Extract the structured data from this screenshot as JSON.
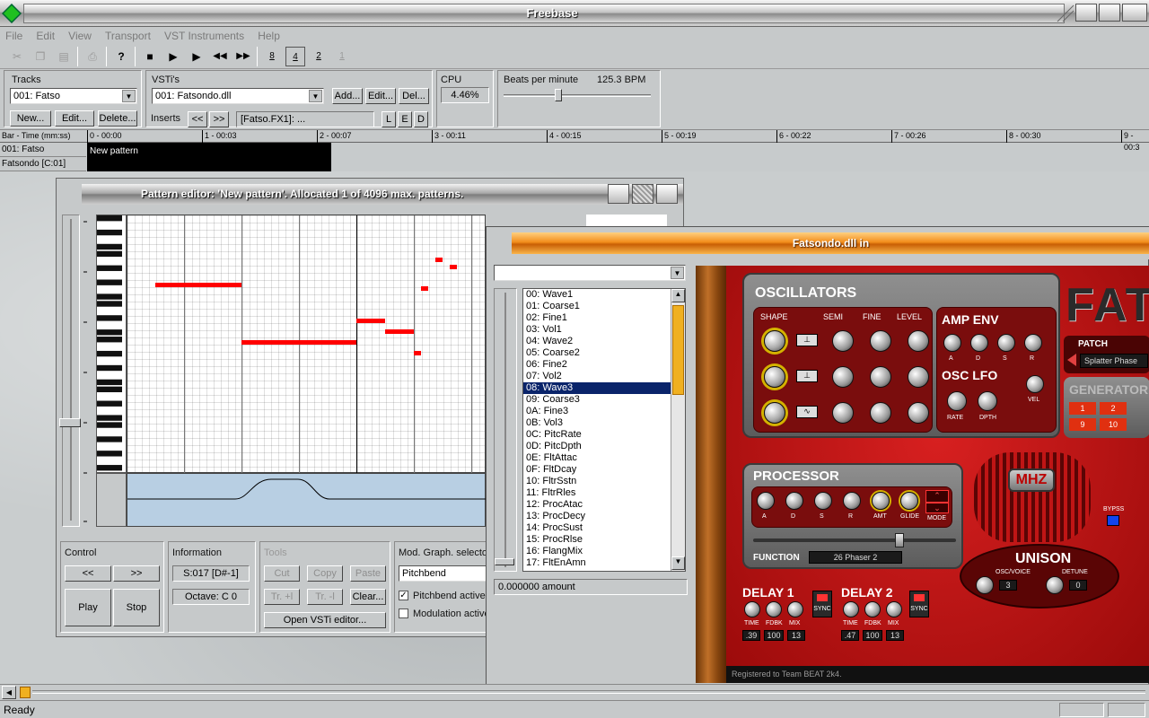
{
  "window": {
    "title": "Freebase"
  },
  "menu": [
    "File",
    "Edit",
    "View",
    "Transport",
    "VST Instruments",
    "Help"
  ],
  "tracks": {
    "label": "Tracks",
    "selected": "001: Fatso",
    "new": "New...",
    "edit": "Edit...",
    "delete": "Delete..."
  },
  "vstis": {
    "label": "VSTi's",
    "selected": "001: Fatsondo.dll",
    "add": "Add...",
    "edit": "Edit...",
    "delete": "Del...",
    "inserts_label": "Inserts",
    "prev": "<<",
    "next": ">>",
    "insert_value": "[Fatso.FX1]: ...",
    "l": "L",
    "e": "E",
    "d": "D"
  },
  "cpu": {
    "label": "CPU",
    "value": "4.46%"
  },
  "bpm": {
    "label": "Beats per minute",
    "value": "125.3 BPM",
    "slider_fraction": 0.35
  },
  "timeline": {
    "header": "Bar - Time (mm:ss)",
    "ticks": [
      "0 - 00:00",
      "1 - 00:03",
      "2 - 00:07",
      "3 - 00:11",
      "4 - 00:15",
      "5 - 00:19",
      "6 - 00:22",
      "7 - 00:26",
      "8 - 00:30",
      "9 - 00:3"
    ]
  },
  "track_rows": [
    {
      "name": "001: Fatso",
      "pattern": "New pattern"
    },
    {
      "name": "Fatsondo [C:01]"
    }
  ],
  "pattern_editor": {
    "title": "Pattern editor: 'New pattern'. Allocated 1 of 4096 max. patterns.",
    "control": {
      "label": "Control",
      "prev": "<<",
      "next": ">>",
      "play": "Play",
      "stop": "Stop"
    },
    "information": {
      "label": "Information",
      "step": "S:017 [D#-1]",
      "octave": "Octave: C 0"
    },
    "tools": {
      "label": "Tools",
      "cut": "Cut",
      "copy": "Copy",
      "paste": "Paste",
      "tr_up": "Tr. +l",
      "tr_down": "Tr. -l",
      "clear": "Clear...",
      "open_vsti": "Open VSTi editor..."
    },
    "mod_graph": {
      "label": "Mod. Graph. selector",
      "selected": "Pitchbend",
      "pitchbend_active": "Pitchbend active",
      "pitchbend_checked": true,
      "modulation_active": "Modulation active",
      "modulation_checked": false
    }
  },
  "vst_window": {
    "title": "Fatsondo.dll in",
    "params": [
      "00: Wave1",
      "01: Coarse1",
      "02: Fine1",
      "03: Vol1",
      "04: Wave2",
      "05: Coarse2",
      "06: Fine2",
      "07: Vol2",
      "08: Wave3",
      "09: Coarse3",
      "0A: Fine3",
      "0B: Vol3",
      "0C: PitcRate",
      "0D: PitcDpth",
      "0E: FltAttac",
      "0F: FltDcay",
      "10: FltrSstn",
      "11: FltrRles",
      "12: ProcAtac",
      "13: ProcDecy",
      "14: ProcSust",
      "15: ProcRlse",
      "16: FlangMix",
      "17: FltEnAmn"
    ],
    "selected_index": 8,
    "amount": "0.000000  amount"
  },
  "synth": {
    "oscillators": "OSCILLATORS",
    "shape": "SHAPE",
    "semi": "SEMI",
    "fine": "FINE",
    "level": "LEVEL",
    "amp_env": "AMP ENV",
    "osc_lfo": "OSC LFO",
    "rate": "RATE",
    "depth": "DPTH",
    "vel": "VEL",
    "a": "A",
    "d": "D",
    "s": "S",
    "r": "R",
    "logo": "FATS",
    "patch_label": "PATCH",
    "patch_name": "Splatter Phase",
    "generator": "GENERATOR",
    "gen_buttons": [
      "1",
      "2",
      "9",
      "10"
    ],
    "processor": "PROCESSOR",
    "amt": "AMT",
    "glide": "GLIDE",
    "mode": "MODE",
    "function_label": "FUNCTION",
    "function_value": "26 Phaser 2",
    "unison": "UNISON",
    "oscvoice": "OSC/VOICE",
    "detune": "DETUNE",
    "osc_value": "3",
    "detune_value": "0",
    "delay1": "DELAY 1",
    "delay2": "DELAY 2",
    "sync": "SYNC",
    "time": "TIME",
    "fdbk": "FDBK",
    "mix": "MIX",
    "d1_values": [
      ".39",
      "100",
      "13"
    ],
    "d2_values": [
      ".47",
      "100",
      "13"
    ],
    "bypass": "BYPSS",
    "registered": "Registered to Team BEAT 2k4."
  },
  "status": {
    "text": "Ready"
  }
}
